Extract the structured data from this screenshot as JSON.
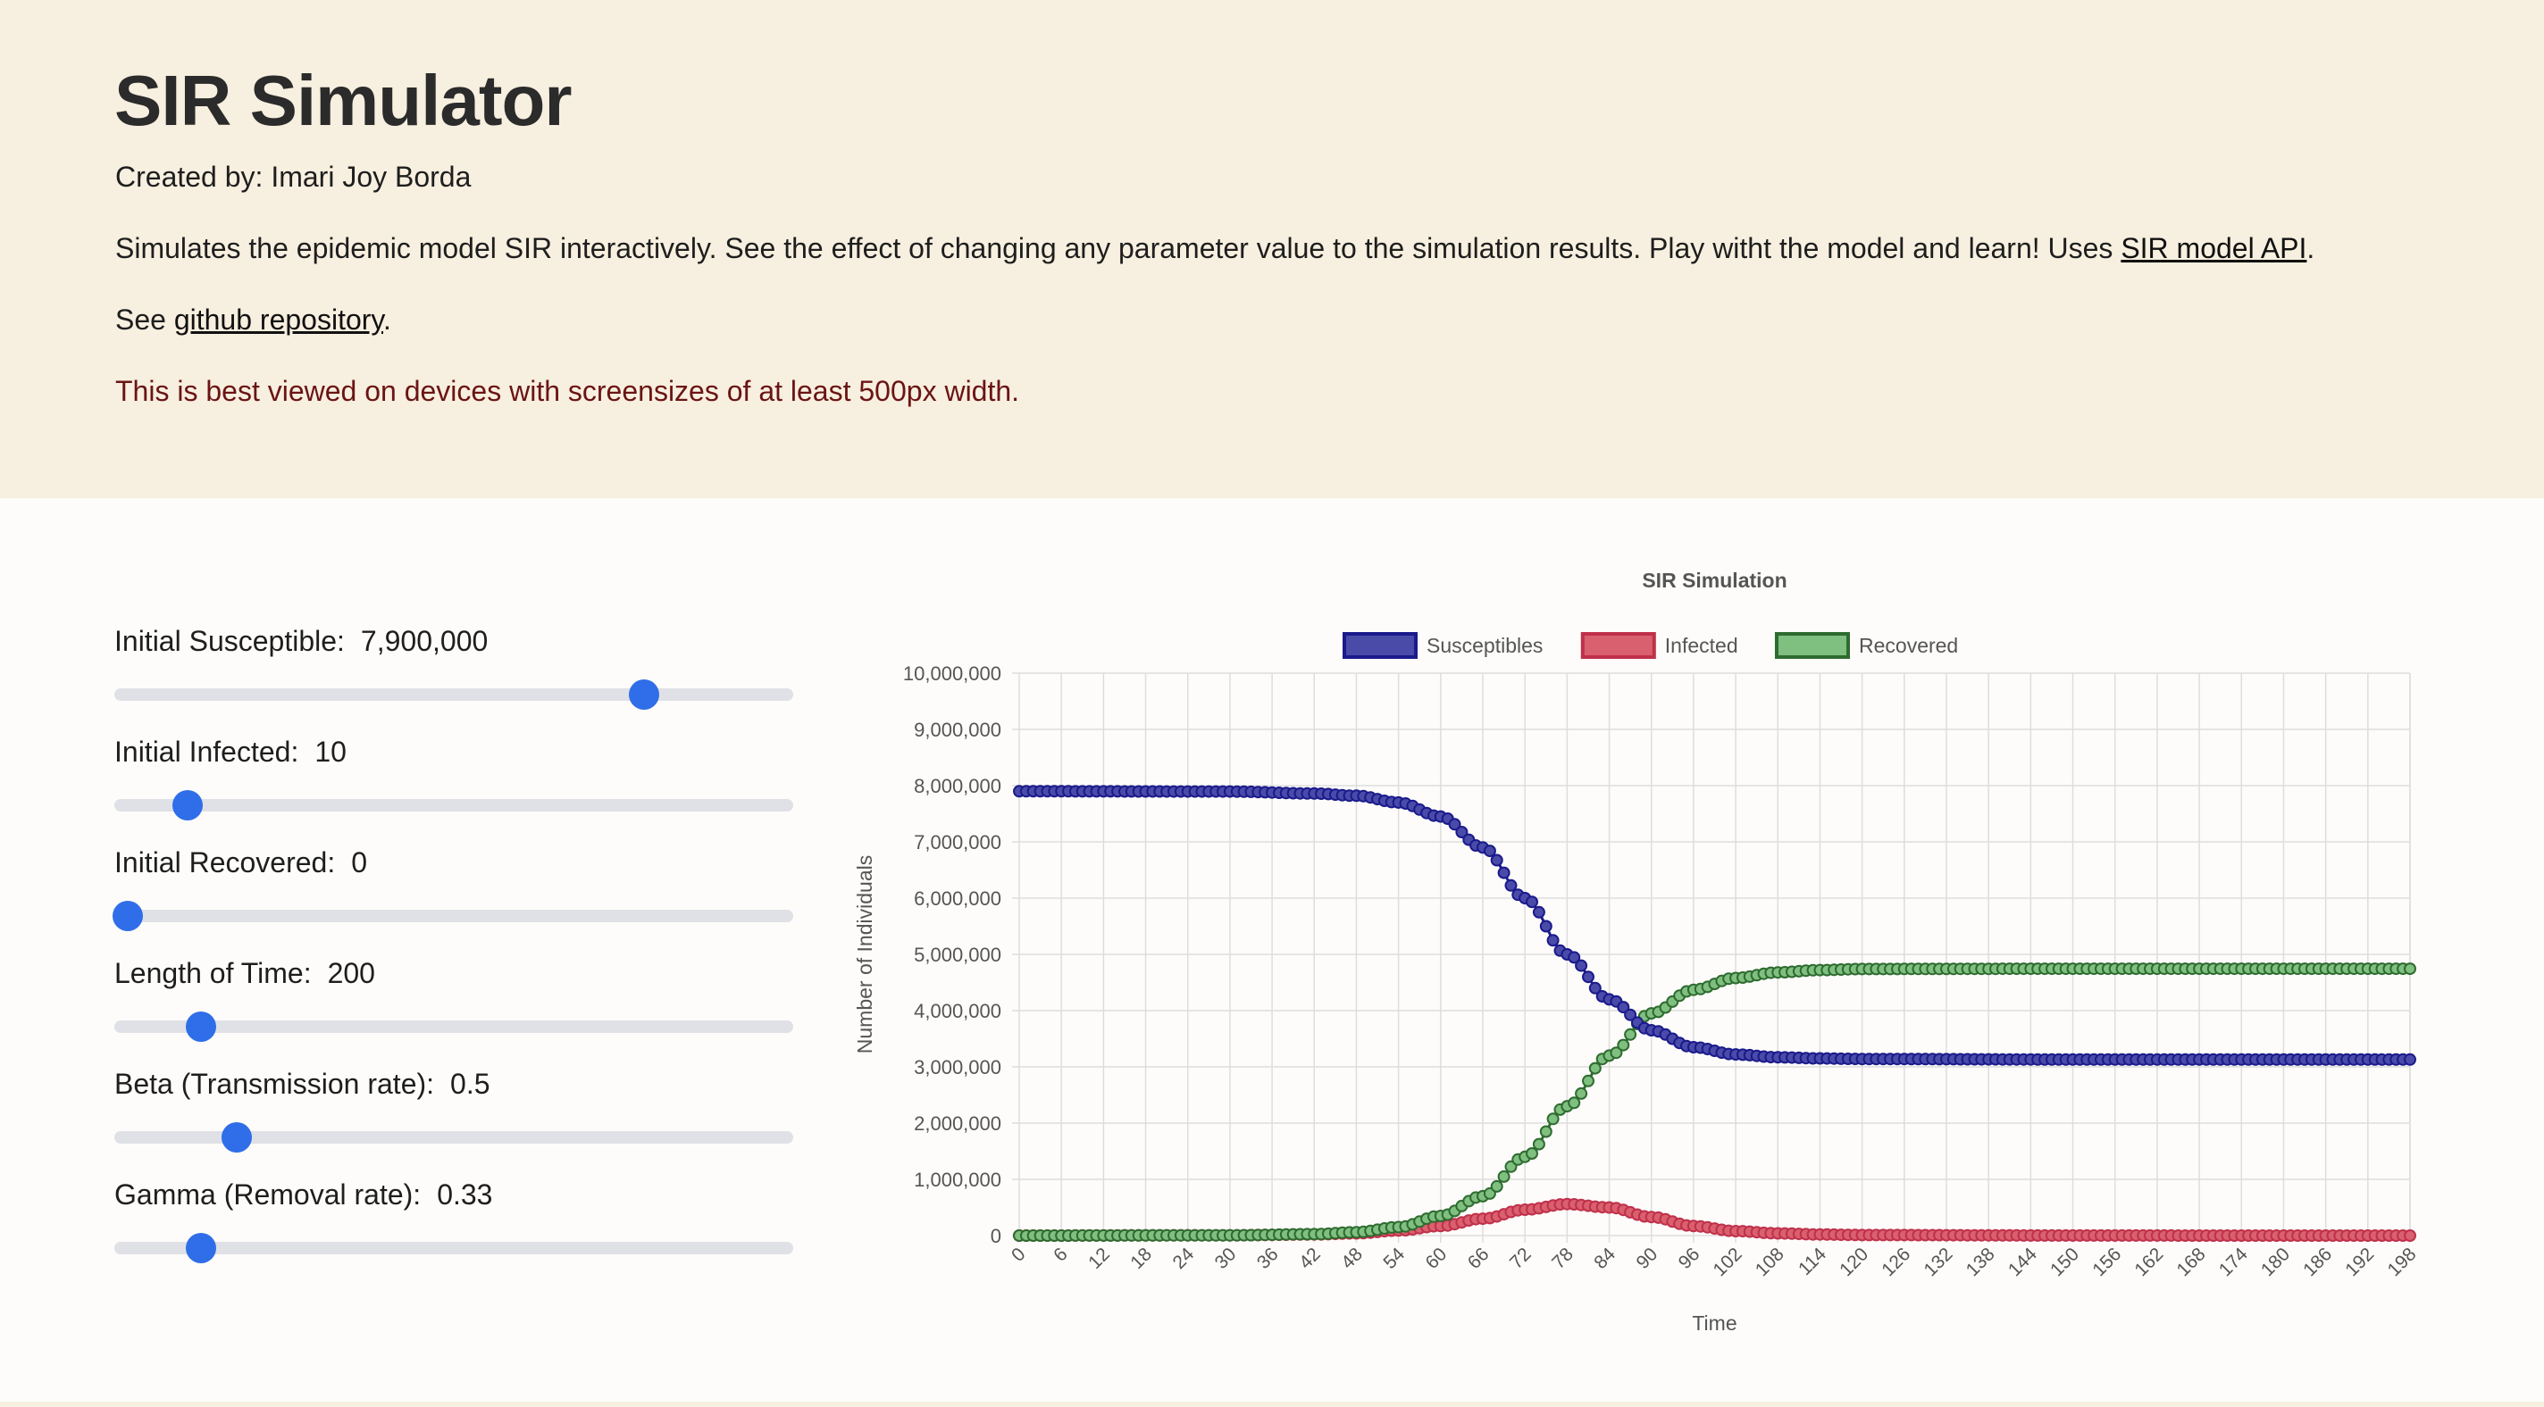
{
  "header": {
    "title": "SIR Simulator",
    "created_by": "Created by: Imari Joy Borda",
    "description": "Simulates the epidemic model SIR interactively. See the effect of changing any parameter value to the simulation results. Play witht the model and learn! Uses ",
    "api_link": "SIR model API",
    "description_end": ".",
    "see_prefix": "See ",
    "repo_link": "github repository",
    "see_suffix": ".",
    "warning": "This is best viewed on devices with screensizes of at least 500px width."
  },
  "controls": [
    {
      "label": "Initial Susceptible:",
      "value": "7,900,000",
      "fraction": 0.78
    },
    {
      "label": "Initial Infected:",
      "value": "10",
      "fraction": 0.108
    },
    {
      "label": "Initial Recovered:",
      "value": "0",
      "fraction": 0.02
    },
    {
      "label": "Length of Time:",
      "value": "200",
      "fraction": 0.127
    },
    {
      "label": "Beta (Transmission rate):",
      "value": "0.5",
      "fraction": 0.18
    },
    {
      "label": "Gamma (Removal rate):",
      "value": "0.33",
      "fraction": 0.127
    }
  ],
  "colors": {
    "susceptible": "#1a1a8c",
    "infected": "#d0384e",
    "recovered": "#2e7d32",
    "slider_thumb": "#2f6ee8",
    "warning": "#6b1414"
  },
  "chart_data": {
    "type": "line",
    "title": "SIR Simulation",
    "xlabel": "Time",
    "ylabel": "Number of Individuals",
    "ylim": [
      0,
      10000000
    ],
    "yticks": [
      "0",
      "1,000,000",
      "2,000,000",
      "3,000,000",
      "4,000,000",
      "5,000,000",
      "6,000,000",
      "7,000,000",
      "8,000,000",
      "9,000,000",
      "10,000,000"
    ],
    "xtick_step": 6,
    "x_start": 0,
    "x_end": 198,
    "legend_position": "top",
    "grid": true,
    "series": [
      {
        "name": "Susceptibles",
        "color": "#1a1a8c",
        "fill": "#4a4aa8",
        "keypoints": [
          [
            0,
            7900000
          ],
          [
            30,
            7895000
          ],
          [
            42,
            7860000
          ],
          [
            48,
            7820000
          ],
          [
            54,
            7700000
          ],
          [
            60,
            7450000
          ],
          [
            66,
            6900000
          ],
          [
            72,
            6000000
          ],
          [
            78,
            5000000
          ],
          [
            84,
            4200000
          ],
          [
            90,
            3650000
          ],
          [
            96,
            3350000
          ],
          [
            102,
            3220000
          ],
          [
            108,
            3170000
          ],
          [
            114,
            3150000
          ],
          [
            120,
            3140000
          ],
          [
            150,
            3130000
          ],
          [
            198,
            3130000
          ]
        ]
      },
      {
        "name": "Infected",
        "color": "#c0304a",
        "fill": "#d9606e",
        "keypoints": [
          [
            0,
            10
          ],
          [
            30,
            5000
          ],
          [
            42,
            20000
          ],
          [
            48,
            40000
          ],
          [
            54,
            90000
          ],
          [
            60,
            170000
          ],
          [
            66,
            300000
          ],
          [
            72,
            460000
          ],
          [
            78,
            560000
          ],
          [
            84,
            500000
          ],
          [
            90,
            330000
          ],
          [
            96,
            170000
          ],
          [
            102,
            80000
          ],
          [
            108,
            40000
          ],
          [
            114,
            20000
          ],
          [
            120,
            10000
          ],
          [
            150,
            1000
          ],
          [
            198,
            0
          ]
        ]
      },
      {
        "name": "Recovered",
        "color": "#2e6b30",
        "fill": "#7fbf7f",
        "keypoints": [
          [
            0,
            0
          ],
          [
            30,
            5000
          ],
          [
            42,
            25000
          ],
          [
            48,
            60000
          ],
          [
            54,
            150000
          ],
          [
            60,
            350000
          ],
          [
            66,
            700000
          ],
          [
            72,
            1400000
          ],
          [
            78,
            2300000
          ],
          [
            84,
            3200000
          ],
          [
            90,
            3950000
          ],
          [
            96,
            4370000
          ],
          [
            102,
            4580000
          ],
          [
            108,
            4680000
          ],
          [
            114,
            4720000
          ],
          [
            120,
            4740000
          ],
          [
            150,
            4745000
          ],
          [
            198,
            4745000
          ]
        ]
      }
    ]
  }
}
